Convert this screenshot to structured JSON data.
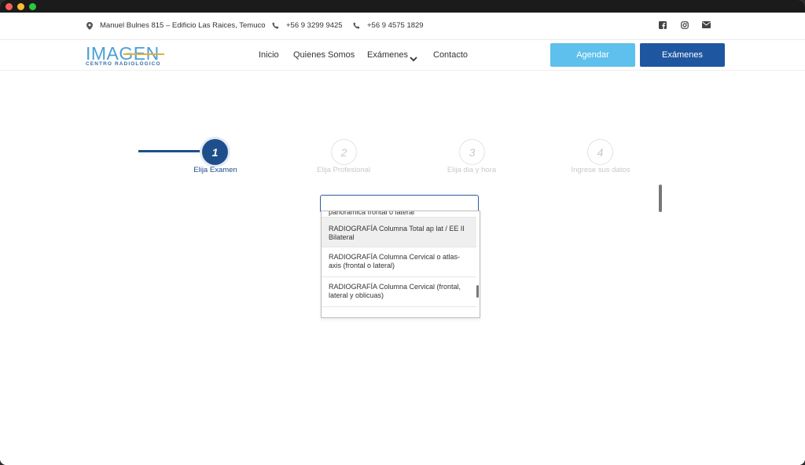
{
  "topbar": {
    "address": "Manuel Bulnes 815 – Edificio Las Raices, Temuco",
    "phone1": "+56 9 3299 9425",
    "phone2": "+56 9 4575 1829",
    "social_icons": [
      "facebook-icon",
      "instagram-icon",
      "envelope-icon"
    ]
  },
  "brand": {
    "name": "IMAGEN",
    "tagline": "CENTRO RADIOLÓGICO"
  },
  "nav": {
    "items": [
      "Inicio",
      "Quienes Somos",
      "Exámenes",
      "Contacto"
    ],
    "agendar_label": "Agendar",
    "examenes_label": "Exámenes"
  },
  "steps": [
    {
      "number": "1",
      "label": "Elija Examen",
      "active": true
    },
    {
      "number": "2",
      "label": "Elija Profesional",
      "active": false
    },
    {
      "number": "3",
      "label": "Elija dia y hora",
      "active": false
    },
    {
      "number": "4",
      "label": "Ingrese sus datos",
      "active": false
    }
  ],
  "exam_select": {
    "value": "",
    "options": [
      "panorámica frontal o lateral",
      "RADIOGRAFÍA Columna Total ap lat / EE II Bilateral",
      "RADIOGRAFÍA Columna Cervical o atlas-axis (frontal o lateral)",
      "RADIOGRAFÍA Columna Cervical (frontal, lateral y oblicuas)"
    ],
    "highlighted_index": 1
  },
  "colors": {
    "primary": "#1e4f8c",
    "accent": "#5ec0ec",
    "button_dark": "#1e56a0"
  }
}
